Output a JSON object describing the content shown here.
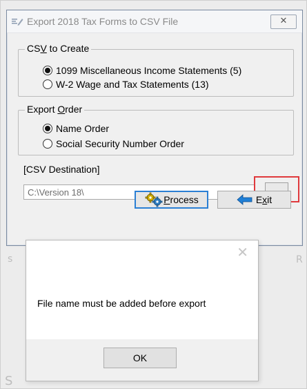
{
  "background": {
    "fragments": [
      "s",
      "R",
      "S"
    ]
  },
  "export_window": {
    "title": "Export 2018 Tax Forms to CSV File",
    "close_glyph": "✕",
    "csv_group": {
      "label_pre": "CS",
      "label_u": "V",
      "label_post": " to Create",
      "options": [
        {
          "label": "1099 Miscellaneous Income Statements (5)",
          "selected": true
        },
        {
          "label": "W-2 Wage and Tax Statements (13)",
          "selected": false
        }
      ]
    },
    "order_group": {
      "label_pre": "Export ",
      "label_u": "O",
      "label_post": "rder",
      "options": [
        {
          "label": "Name Order",
          "selected": true
        },
        {
          "label": "Social Security Number Order",
          "selected": false
        }
      ]
    },
    "destination": {
      "label": "[CSV Destination]",
      "value": "C:\\Version 18\\",
      "browse_label": "..."
    },
    "process_button": {
      "label_u": "P",
      "label_post": "rocess"
    },
    "exit_button": {
      "label_pre": "E",
      "label_u": "x",
      "label_post": "it"
    },
    "colors": {
      "highlight": "#e0393c",
      "focus": "#2a7fd4"
    }
  },
  "message_dialog": {
    "close_glyph": "✕",
    "message": "File name must be added before export",
    "ok_label": "OK"
  }
}
